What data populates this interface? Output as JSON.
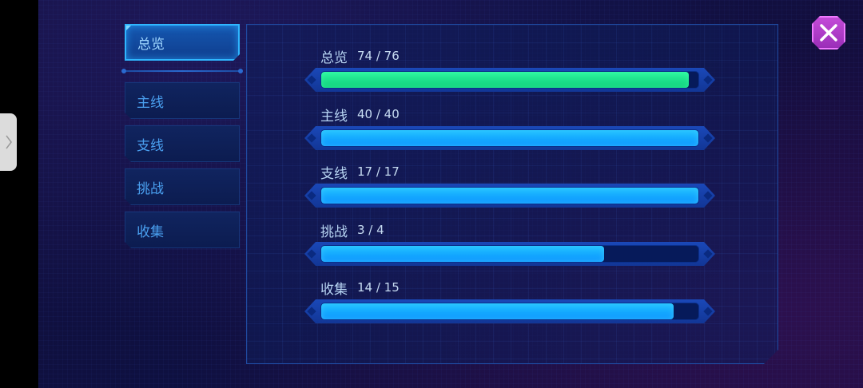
{
  "tabs": [
    {
      "label": "总览",
      "active": true
    },
    {
      "label": "主线",
      "active": false
    },
    {
      "label": "支线",
      "active": false
    },
    {
      "label": "挑战",
      "active": false
    },
    {
      "label": "收集",
      "active": false
    }
  ],
  "progress_rows": [
    {
      "label": "总览",
      "count": "74 / 76",
      "current": 74,
      "total": 76,
      "color": "#1fe08a"
    },
    {
      "label": "主线",
      "count": "40 / 40",
      "current": 40,
      "total": 40,
      "color": "#14aaff"
    },
    {
      "label": "支线",
      "count": "17 / 17",
      "current": 17,
      "total": 17,
      "color": "#14aaff"
    },
    {
      "label": "挑战",
      "count": "3 / 4",
      "current": 3,
      "total": 4,
      "color": "#14aaff"
    },
    {
      "label": "收集",
      "count": "14 / 15",
      "current": 14,
      "total": 15,
      "color": "#14aaff"
    }
  ],
  "icons": {
    "close": "close-icon",
    "side_handle": "chevron-right-icon"
  },
  "colors": {
    "accent": "#2fb6ff",
    "close_button": "#b53ccf"
  }
}
